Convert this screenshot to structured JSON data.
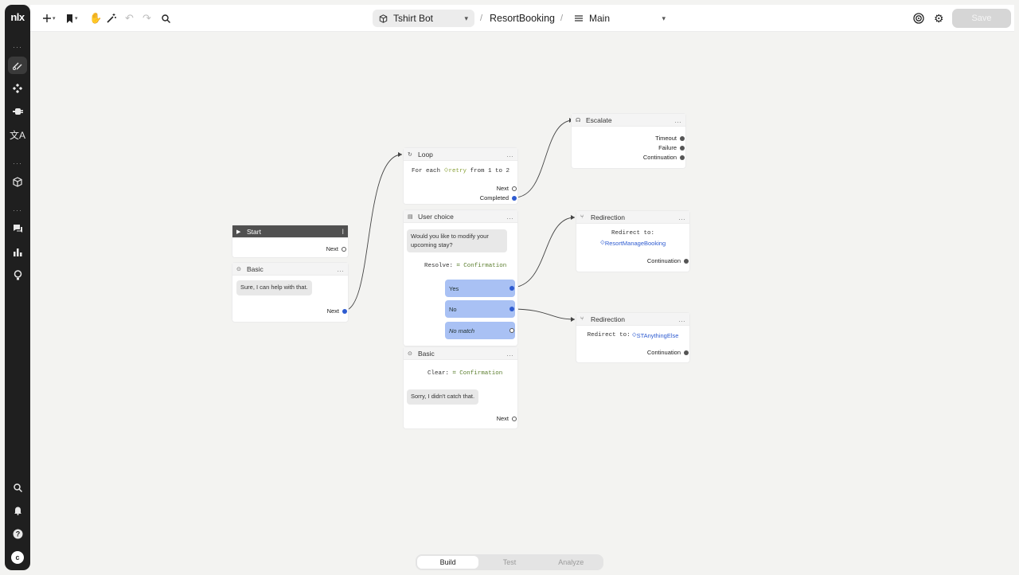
{
  "sidebar": {
    "logo": "nlx",
    "avatar_initial": "c",
    "items": [
      {
        "icon": "flows-icon"
      },
      {
        "icon": "components-icon"
      },
      {
        "icon": "integrations-icon"
      },
      {
        "icon": "translate-icon"
      },
      {
        "icon": "box-icon"
      },
      {
        "icon": "conversations-icon"
      },
      {
        "icon": "analytics-icon"
      },
      {
        "icon": "idea-icon"
      }
    ],
    "separator": "···"
  },
  "topbar": {
    "bot_name": "Tshirt Bot",
    "flow_name": "ResortBooking",
    "page_name": "Main",
    "breadcrumb_sep": "/",
    "save_label": "Save"
  },
  "nodes": {
    "start": {
      "title": "Start",
      "next": "Next"
    },
    "basic1": {
      "title": "Basic",
      "message": "Sure, I can help with that.",
      "next": "Next"
    },
    "loop": {
      "title": "Loop",
      "for_each": "For each",
      "var": "retry",
      "range": "from 1 to 2",
      "next": "Next",
      "completed": "Completed"
    },
    "user_choice": {
      "title": "User choice",
      "prompt": "Would you like to modify your upcoming stay?",
      "resolve_label": "Resolve:",
      "resolve_var": "Confirmation",
      "choices": [
        "Yes",
        "No",
        "No match"
      ]
    },
    "basic2": {
      "title": "Basic",
      "clear_label": "Clear:",
      "clear_var": "Confirmation",
      "message": "Sorry, I didn't catch that.",
      "next": "Next"
    },
    "escalate": {
      "title": "Escalate",
      "outputs": [
        "Timeout",
        "Failure",
        "Continuation"
      ]
    },
    "redirect1": {
      "title": "Redirection",
      "redirect_label": "Redirect to:",
      "target": "ResortManageBooking",
      "continuation": "Continuation"
    },
    "redirect2": {
      "title": "Redirection",
      "redirect_label": "Redirect to:",
      "target": "STAnythingElse",
      "continuation": "Continuation"
    }
  },
  "modes": [
    "Build",
    "Test",
    "Analyze"
  ],
  "active_mode": "Build",
  "colors": {
    "sidebar": "#1f1f1f",
    "choice": "#a9c1f4",
    "port": "#2e5bd0",
    "canvas": "#f3f3f1"
  }
}
